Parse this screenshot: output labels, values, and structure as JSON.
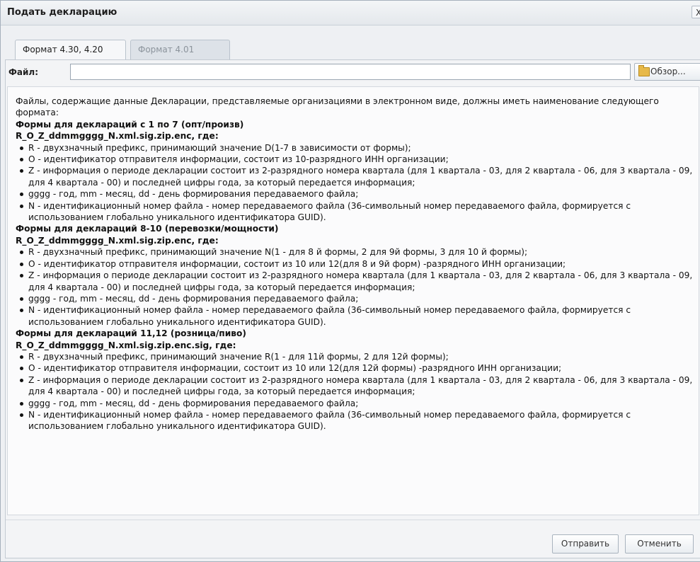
{
  "window": {
    "title": "Подать декларацию",
    "close_label": "X"
  },
  "tabs": [
    {
      "label": "Формат 4.30, 4.20",
      "active": true
    },
    {
      "label": "Формат 4.01",
      "active": false
    }
  ],
  "file": {
    "label": "Файл:",
    "value": "",
    "browse_label": "Обзор...",
    "browse_icon": "folder-icon"
  },
  "content": {
    "intro": "Файлы, содержащие данные Декларации, представляемые организациями в электронном виде, должны иметь наименование следующего формата:",
    "sections": [
      {
        "title": "Формы для деклараций с 1 по 7 (опт/произв)",
        "pattern": "R_O_Z_ddmmgggg_N.xml.sig.zip.enc, где:",
        "items": [
          "R - двухзначный префикс, принимающий значение D(1-7 в зависимости от формы);",
          "O - идентификатор отправителя информации, состоит из 10-разрядного ИНН организации;",
          "Z - информация о периоде декларации состоит из 2-разрядного номера квартала (для 1 квартала - 03, для 2 квартала - 06, для 3 квартала - 09, для 4 квартала - 00) и последней цифры года, за который передается информация;",
          "gggg - год, mm - месяц, dd - день формирования передаваемого файла;",
          "N - идентификационный номер файла - номер передаваемого файла (36-символьный номер передаваемого файла, формируется с использованием глобально уникального идентификатора GUID)."
        ]
      },
      {
        "title": "Формы для деклараций 8-10 (перевозки/мощности)",
        "pattern": "R_O_Z_ddmmgggg_N.xml.sig.zip.enc, где:",
        "items": [
          "R - двухзначный префикс, принимающий значение N(1 - для 8 й формы, 2 для 9й формы, 3 для 10 й формы);",
          "O - идентификатор отправителя информации, состоит из 10 или 12(для 8 и 9й форм) -разрядного ИНН организации;",
          "Z - информация о периоде декларации состоит из 2-разрядного номера квартала (для 1 квартала - 03, для 2 квартала - 06, для 3 квартала - 09, для 4 квартала - 00) и последней цифры года, за который передается информация;",
          "gggg - год, mm - месяц, dd - день формирования передаваемого файла;",
          "N - идентификационный номер файла - номер передаваемого файла (36-символьный номер передаваемого файла, формируется с использованием глобально уникального идентификатора GUID)."
        ]
      },
      {
        "title": "Формы для деклараций 11,12 (розница/пиво)",
        "pattern": "R_O_Z_ddmmgggg_N.xml.sig.zip.enc.sig, где:",
        "items": [
          "R - двухзначный префикс, принимающий значение R(1 - для 11й формы, 2 для 12й формы);",
          "O - идентификатор отправителя информации, состоит из 10 или 12(для 12й формы) -разрядного ИНН организации;",
          "Z - информация о периоде декларации состоит из 2-разрядного номера квартала (для 1 квартала - 03, для 2 квартала - 06, для 3 квартала - 09, для 4 квартала - 00) и последней цифры года, за который передается информация;",
          "gggg - год, mm - месяц, dd - день формирования передаваемого файла;",
          "N - идентификационный номер файла - номер передаваемого файла (36-символьный номер передаваемого файла, формируется с использованием глобально уникального идентификатора GUID)."
        ]
      }
    ]
  },
  "buttons": {
    "send_label": "Отправить",
    "cancel_label": "Отменить"
  }
}
